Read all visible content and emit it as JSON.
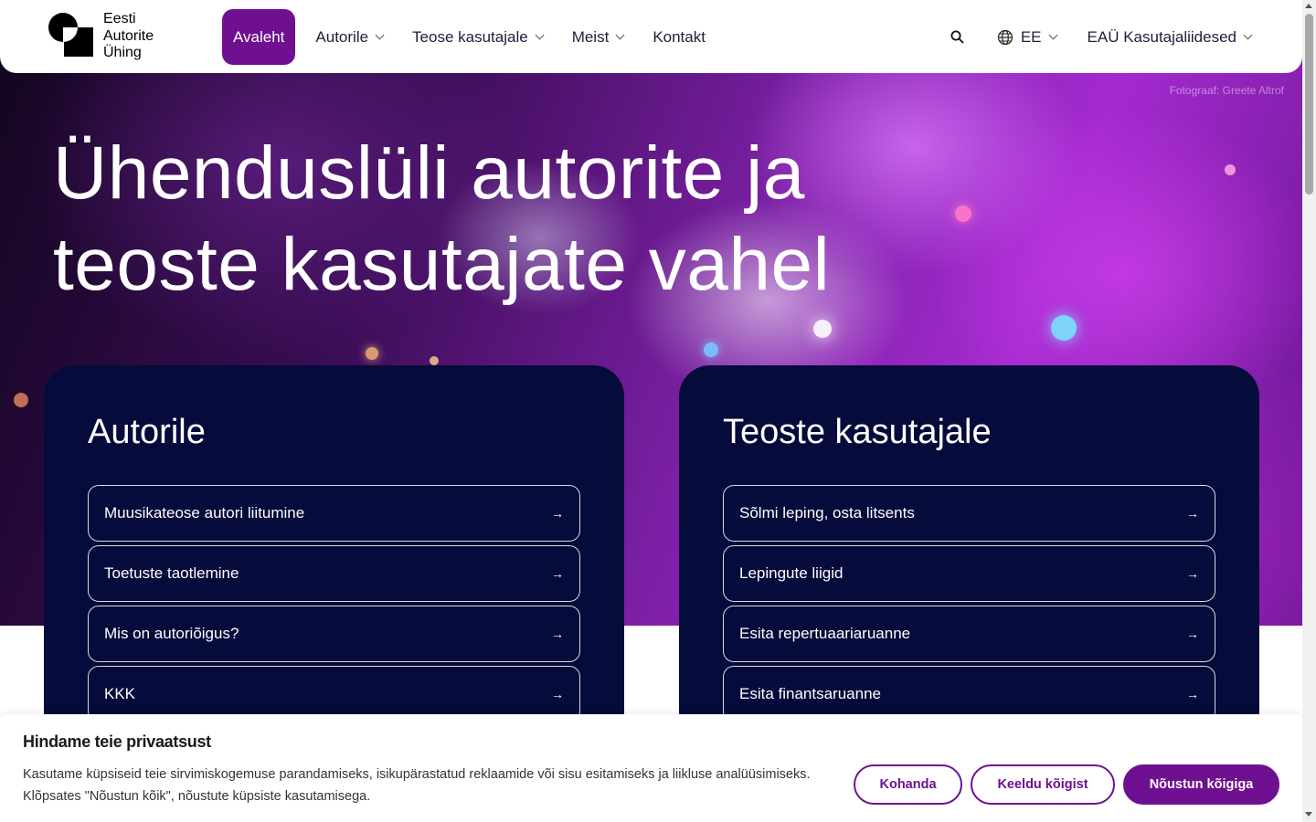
{
  "header": {
    "logo_lines": [
      "Eesti",
      "Autorite",
      "Ühing"
    ],
    "nav": [
      {
        "label": "Avaleht",
        "active": true,
        "dropdown": false
      },
      {
        "label": "Autorile",
        "active": false,
        "dropdown": true
      },
      {
        "label": "Teose kasutajale",
        "active": false,
        "dropdown": true
      },
      {
        "label": "Meist",
        "active": false,
        "dropdown": true
      },
      {
        "label": "Kontakt",
        "active": false,
        "dropdown": false
      }
    ],
    "search_icon": "search-icon",
    "language": "EE",
    "portal": "EAÜ Kasutajaliidesed"
  },
  "hero": {
    "photo_credit": "Fotograaf: Greete Altrof",
    "title_line1": "Ühenduslüli autorite ja",
    "title_line2": "teoste kasutajate vahel"
  },
  "cards": [
    {
      "title": "Autorile",
      "links": [
        "Muusikateose autori liitumine",
        "Toetuste taotlemine",
        "Mis on autoriõigus?",
        "KKK"
      ]
    },
    {
      "title": "Teoste kasutajale",
      "links": [
        "Sõlmi leping, osta litsents",
        "Lepingute liigid",
        "Esita repertuaariaruanne",
        "Esita finantsaruanne"
      ]
    }
  ],
  "cookie": {
    "title": "Hindame teie privaatsust",
    "text_line1": "Kasutame küpsiseid teie sirvimiskogemuse parandamiseks, isikupärastatud reklaamide või sisu esitamiseks ja liikluse analüüsimiseks.",
    "text_line2": "Klõpsates \"Nõustun kõik\", nõustute küpsiste kasutamisega.",
    "btn_customize": "Kohanda",
    "btn_reject": "Keeldu kõigist",
    "btn_accept": "Nõustun kõigiga"
  },
  "colors": {
    "brand_purple": "#6f1090",
    "card_navy": "#050b3a"
  }
}
